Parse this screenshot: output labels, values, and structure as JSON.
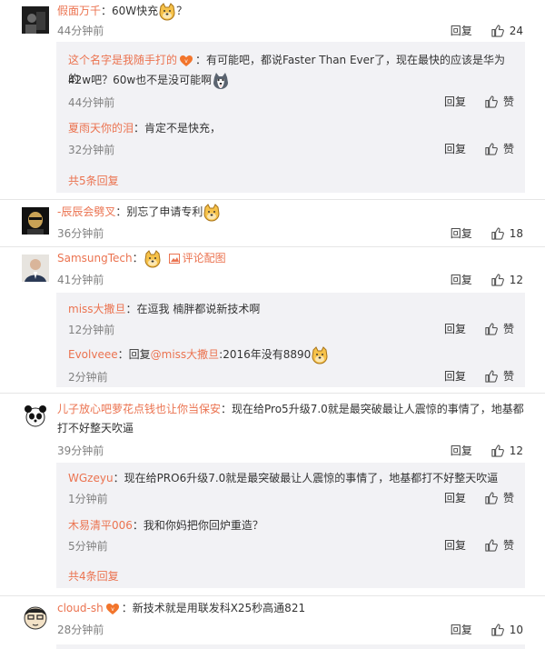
{
  "ui": {
    "reply": "回复",
    "like": "赞"
  },
  "comments": [
    {
      "user": "假面万千",
      "text": "：60W快充",
      "text_tail": "？",
      "time": "44分钟前",
      "likes": "24",
      "replies": [
        {
          "user": "这个名字是我随手打的",
          "text": "：有可能吧，都说Faster Than Ever了，现在最快的应该是华为的",
          "text2": "42w吧？60w也不是没可能啊",
          "time": "44分钟前"
        },
        {
          "user": "夏雨天你的泪",
          "text": "：肯定不是快充，",
          "time": "32分钟前"
        }
      ],
      "more": "共5条回复"
    },
    {
      "user": "-辰辰会劈叉",
      "text": "：别忘了申请专利",
      "time": "36分钟前",
      "likes": "18"
    },
    {
      "user": "SamsungTech",
      "text": "：",
      "pic_link": "评论配图",
      "time": "41分钟前",
      "likes": "12",
      "replies": [
        {
          "user": "miss大撒旦",
          "text": "：在逗我  楠胖都说新技术啊",
          "time": "12分钟前"
        },
        {
          "user": "Evolveee",
          "text": "：回复",
          "mention": "@miss大撒旦",
          "text_after": ":2016年没有8890",
          "time": "2分钟前"
        }
      ]
    },
    {
      "user": "儿子放心吧萝花点钱也让你当保安",
      "text": "：现在给Pro5升级7.0就是最突破最让人震惊的事情了，地基都",
      "text2": "打不好整天吹逼",
      "time": "39分钟前",
      "likes": "12",
      "replies": [
        {
          "user": "WGzeyu",
          "text": "：现在给PRO6升级7.0就是最突破最让人震惊的事情了，地基都打不好整天吹逼",
          "time": "1分钟前"
        },
        {
          "user": "木易清平006",
          "text": "：我和你妈把你回炉重造？",
          "time": "5分钟前"
        }
      ],
      "more": "共4条回复"
    },
    {
      "user": "cloud-sh",
      "text": "：新技术就是用联发科X25秒高通821",
      "time": "28分钟前",
      "likes": "10"
    }
  ]
}
